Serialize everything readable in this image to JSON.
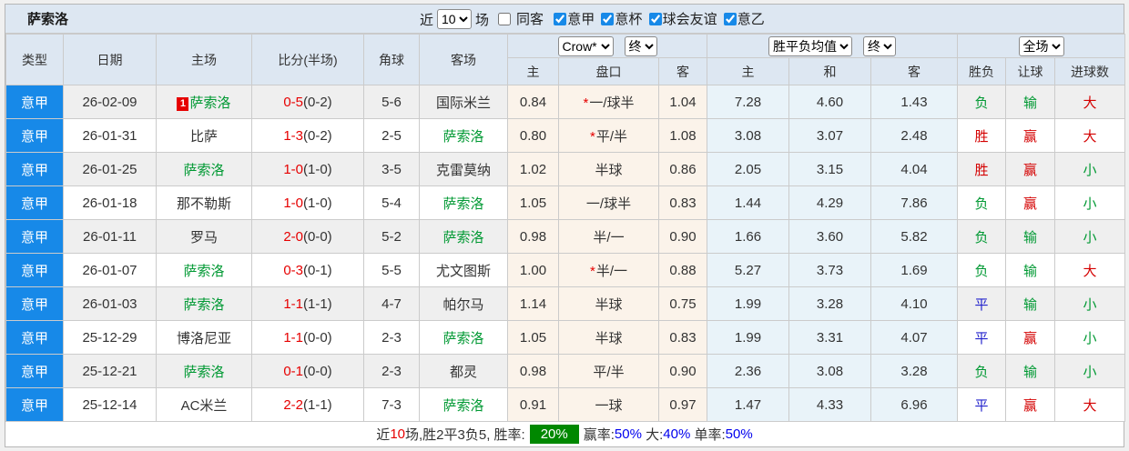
{
  "title": "萨索洛",
  "filter_bar": {
    "recent_label": "近",
    "recent_value": "10",
    "matches_label": "场",
    "checkboxes": [
      {
        "label": "同客",
        "checked": false,
        "c": "cb-gap"
      },
      {
        "label": "意甲",
        "checked": true,
        "c": ""
      },
      {
        "label": "意杯",
        "checked": true,
        "c": ""
      },
      {
        "label": "球会友谊",
        "checked": true,
        "c": ""
      },
      {
        "label": "意乙",
        "checked": true,
        "c": ""
      }
    ]
  },
  "selectors": {
    "company": "Crow*",
    "company_time": "终",
    "avg": "胜平负均值",
    "avg_time": "终",
    "scope": "全场"
  },
  "columns": {
    "type": "类型",
    "date": "日期",
    "home": "主场",
    "score": "比分(半场)",
    "corners": "角球",
    "away": "客场",
    "odds_home": "主",
    "handicap": "盘口",
    "odds_away": "客",
    "avg_home": "主",
    "avg_draw": "和",
    "avg_away": "客",
    "result": "胜负",
    "handicap_result": "让球",
    "goals": "进球数"
  },
  "rows": [
    {
      "league": "意甲",
      "date": "26-02-09",
      "home": "萨索洛",
      "home_c": "t-green",
      "red_card": "1",
      "ft": "0-5",
      "ht": "(0-2)",
      "corners": "5-6",
      "away": "国际米兰",
      "away_c": "",
      "oh": "0.84",
      "star": true,
      "hcap": "一/球半",
      "oa": "1.04",
      "ah": "7.28",
      "ad": "4.60",
      "aa": "1.43",
      "res": "负",
      "res_c": "t-green",
      "hr": "输",
      "hr_c": "t-green",
      "g": "大",
      "g_c": "t-red"
    },
    {
      "league": "意甲",
      "date": "26-01-31",
      "home": "比萨",
      "home_c": "",
      "red_card": "",
      "ft": "1-3",
      "ht": "(0-2)",
      "corners": "2-5",
      "away": "萨索洛",
      "away_c": "t-green",
      "oh": "0.80",
      "star": true,
      "hcap": "平/半",
      "oa": "1.08",
      "ah": "3.08",
      "ad": "3.07",
      "aa": "2.48",
      "res": "胜",
      "res_c": "t-red",
      "hr": "赢",
      "hr_c": "t-red",
      "g": "大",
      "g_c": "t-red"
    },
    {
      "league": "意甲",
      "date": "26-01-25",
      "home": "萨索洛",
      "home_c": "t-green",
      "red_card": "",
      "ft": "1-0",
      "ht": "(1-0)",
      "corners": "3-5",
      "away": "克雷莫纳",
      "away_c": "",
      "oh": "1.02",
      "star": false,
      "hcap": "半球",
      "oa": "0.86",
      "ah": "2.05",
      "ad": "3.15",
      "aa": "4.04",
      "res": "胜",
      "res_c": "t-red",
      "hr": "赢",
      "hr_c": "t-red",
      "g": "小",
      "g_c": "t-green"
    },
    {
      "league": "意甲",
      "date": "26-01-18",
      "home": "那不勒斯",
      "home_c": "",
      "red_card": "",
      "ft": "1-0",
      "ht": "(1-0)",
      "corners": "5-4",
      "away": "萨索洛",
      "away_c": "t-green",
      "oh": "1.05",
      "star": false,
      "hcap": "一/球半",
      "oa": "0.83",
      "ah": "1.44",
      "ad": "4.29",
      "aa": "7.86",
      "res": "负",
      "res_c": "t-green",
      "hr": "赢",
      "hr_c": "t-red",
      "g": "小",
      "g_c": "t-green"
    },
    {
      "league": "意甲",
      "date": "26-01-11",
      "home": "罗马",
      "home_c": "",
      "red_card": "",
      "ft": "2-0",
      "ht": "(0-0)",
      "corners": "5-2",
      "away": "萨索洛",
      "away_c": "t-green",
      "oh": "0.98",
      "star": false,
      "hcap": "半/一",
      "oa": "0.90",
      "ah": "1.66",
      "ad": "3.60",
      "aa": "5.82",
      "res": "负",
      "res_c": "t-green",
      "hr": "输",
      "hr_c": "t-green",
      "g": "小",
      "g_c": "t-green"
    },
    {
      "league": "意甲",
      "date": "26-01-07",
      "home": "萨索洛",
      "home_c": "t-green",
      "red_card": "",
      "ft": "0-3",
      "ht": "(0-1)",
      "corners": "5-5",
      "away": "尤文图斯",
      "away_c": "",
      "oh": "1.00",
      "star": true,
      "hcap": "半/一",
      "oa": "0.88",
      "ah": "5.27",
      "ad": "3.73",
      "aa": "1.69",
      "res": "负",
      "res_c": "t-green",
      "hr": "输",
      "hr_c": "t-green",
      "g": "大",
      "g_c": "t-red"
    },
    {
      "league": "意甲",
      "date": "26-01-03",
      "home": "萨索洛",
      "home_c": "t-green",
      "red_card": "",
      "ft": "1-1",
      "ht": "(1-1)",
      "corners": "4-7",
      "away": "帕尔马",
      "away_c": "",
      "oh": "1.14",
      "star": false,
      "hcap": "半球",
      "oa": "0.75",
      "ah": "1.99",
      "ad": "3.28",
      "aa": "4.10",
      "res": "平",
      "res_c": "t-blue",
      "hr": "输",
      "hr_c": "t-green",
      "g": "小",
      "g_c": "t-green"
    },
    {
      "league": "意甲",
      "date": "25-12-29",
      "home": "博洛尼亚",
      "home_c": "",
      "red_card": "",
      "ft": "1-1",
      "ht": "(0-0)",
      "corners": "2-3",
      "away": "萨索洛",
      "away_c": "t-green",
      "oh": "1.05",
      "star": false,
      "hcap": "半球",
      "oa": "0.83",
      "ah": "1.99",
      "ad": "3.31",
      "aa": "4.07",
      "res": "平",
      "res_c": "t-blue",
      "hr": "赢",
      "hr_c": "t-red",
      "g": "小",
      "g_c": "t-green"
    },
    {
      "league": "意甲",
      "date": "25-12-21",
      "home": "萨索洛",
      "home_c": "t-green",
      "red_card": "",
      "ft": "0-1",
      "ht": "(0-0)",
      "corners": "2-3",
      "away": "都灵",
      "away_c": "",
      "oh": "0.98",
      "star": false,
      "hcap": "平/半",
      "oa": "0.90",
      "ah": "2.36",
      "ad": "3.08",
      "aa": "3.28",
      "res": "负",
      "res_c": "t-green",
      "hr": "输",
      "hr_c": "t-green",
      "g": "小",
      "g_c": "t-green"
    },
    {
      "league": "意甲",
      "date": "25-12-14",
      "home": "AC米兰",
      "home_c": "",
      "red_card": "",
      "ft": "2-2",
      "ht": "(1-1)",
      "corners": "7-3",
      "away": "萨索洛",
      "away_c": "t-green",
      "oh": "0.91",
      "star": false,
      "hcap": "一球",
      "oa": "0.97",
      "ah": "1.47",
      "ad": "4.33",
      "aa": "6.96",
      "res": "平",
      "res_c": "t-blue",
      "hr": "赢",
      "hr_c": "t-red",
      "g": "大",
      "g_c": "t-red"
    }
  ],
  "footer": {
    "parts": [
      {
        "t": "近",
        "c": "fx-dark"
      },
      {
        "t": "10",
        "c": "fx-red"
      },
      {
        "t": "场,胜2平3负5, 胜率:",
        "c": "fx-dark"
      },
      {
        "t": "20%",
        "c": "fx-badge"
      },
      {
        "t": "赢率:",
        "c": "fx-dark"
      },
      {
        "t": "50%",
        "c": "fx-blue"
      },
      {
        "t": " 大:",
        "c": "fx-dark"
      },
      {
        "t": "40%",
        "c": "fx-blue"
      },
      {
        "t": " 单率:",
        "c": "fx-dark"
      },
      {
        "t": "50%",
        "c": "fx-blue"
      }
    ]
  }
}
